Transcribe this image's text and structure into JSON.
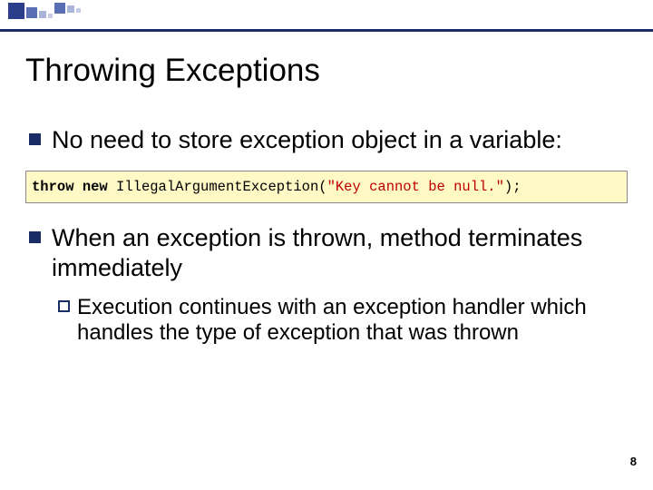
{
  "slide": {
    "title": "Throwing Exceptions",
    "bullets": [
      {
        "text": "No need to store exception object in a variable:"
      },
      {
        "text": "When an exception is thrown, method terminates immediately"
      }
    ],
    "code": {
      "kw1": "throw",
      "kw2": "new",
      "cls": " IllegalArgumentException(",
      "str": "\"Key cannot be null.\"",
      "tail": ");"
    },
    "sub": {
      "text": "Execution continues with an exception handler which handles the type of exception that was thrown"
    },
    "page": "8"
  }
}
